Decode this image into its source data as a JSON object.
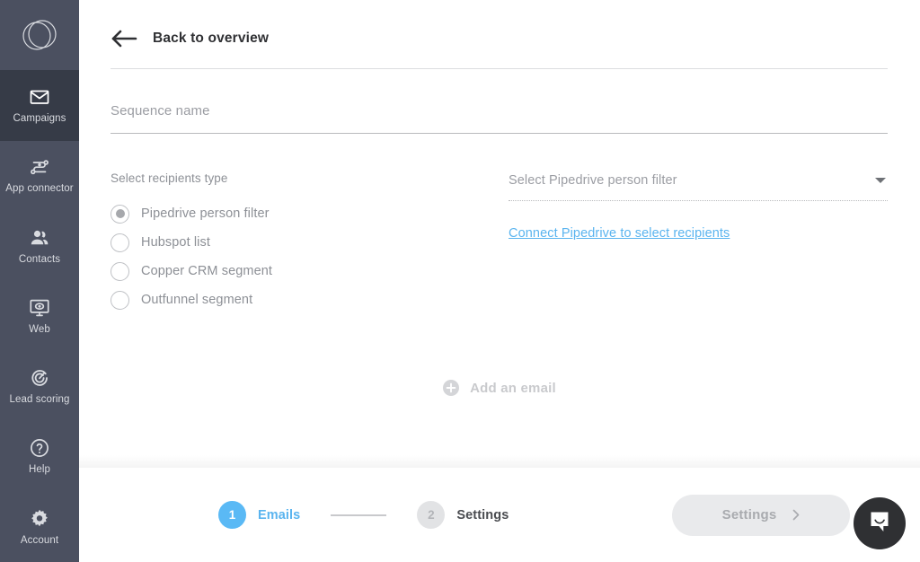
{
  "sidebar": {
    "logo": {
      "icon": "overlapping-circles-logo"
    },
    "items": [
      {
        "label": "Campaigns",
        "icon": "envelope-icon",
        "active": true
      },
      {
        "label": "App connector",
        "icon": "connector-icon",
        "active": false
      },
      {
        "label": "Contacts",
        "icon": "contacts-icon",
        "active": false
      },
      {
        "label": "Web",
        "icon": "monitor-eye-icon",
        "active": false
      },
      {
        "label": "Lead scoring",
        "icon": "radar-target-icon",
        "active": false
      },
      {
        "label": "Help",
        "icon": "question-mark-icon",
        "active": false
      },
      {
        "label": "Account",
        "icon": "gear-icon",
        "active": false
      }
    ]
  },
  "header": {
    "back_label": "Back to overview",
    "back_icon": "arrow-left-icon"
  },
  "sequence_name": {
    "placeholder": "Sequence name",
    "value": ""
  },
  "recipients": {
    "label": "Select recipients type",
    "options": [
      {
        "label": "Pipedrive person filter",
        "selected": true
      },
      {
        "label": "Hubspot list",
        "selected": false
      },
      {
        "label": "Copper CRM segment",
        "selected": false
      },
      {
        "label": "Outfunnel segment",
        "selected": false
      }
    ]
  },
  "filter_select": {
    "placeholder": "Select Pipedrive person filter",
    "value": "",
    "caret_icon": "chevron-down-icon",
    "disabled": true
  },
  "connect_link": {
    "label": "Connect Pipedrive to select recipients"
  },
  "add_email": {
    "label": "Add an email",
    "icon": "plus-circle-icon",
    "disabled": true
  },
  "footer": {
    "steps": [
      {
        "number": "1",
        "label": "Emails",
        "state": "active"
      },
      {
        "number": "2",
        "label": "Settings",
        "state": "inactive"
      }
    ],
    "next_button": {
      "label": "Settings",
      "icon": "chevron-right-icon",
      "disabled": true
    }
  },
  "chat": {
    "icon": "chat-bubble-smile-icon"
  },
  "colors": {
    "sidebar_bg": "#4b5060",
    "sidebar_active_bg": "#363b47",
    "accent_blue": "#5ab9f5",
    "link_blue": "#5ab4ef",
    "muted_gray": "#8d9096",
    "chat_dark": "#2f3033"
  }
}
